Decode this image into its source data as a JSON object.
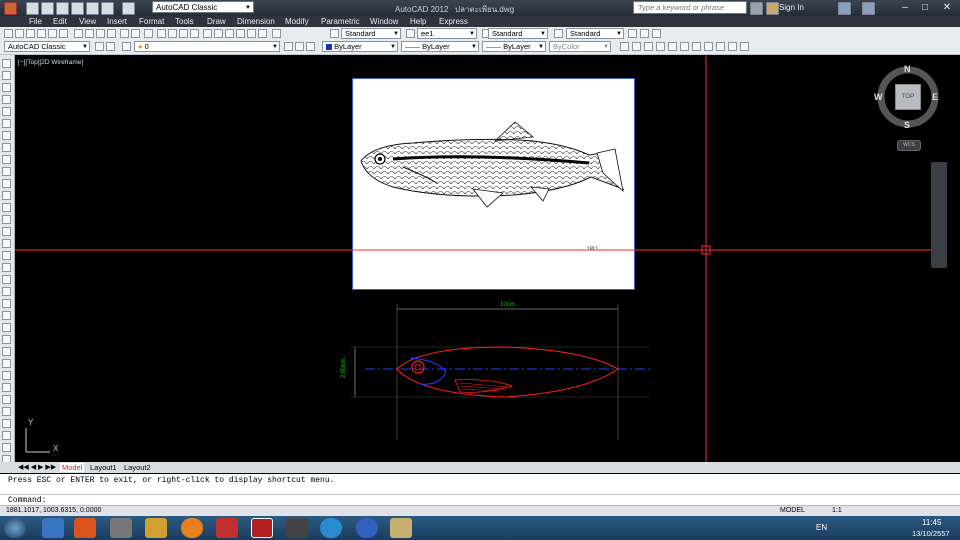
{
  "titlebar": {
    "workspace": "AutoCAD Classic",
    "app_title": "AutoCAD 2012",
    "file_name": "ปลาตะเพียน.dwg",
    "search_placeholder": "Type a keyword or phrase",
    "sign_in": "Sign In"
  },
  "menu": [
    "File",
    "Edit",
    "View",
    "Insert",
    "Format",
    "Tools",
    "Draw",
    "Dimension",
    "Modify",
    "Parametric",
    "Window",
    "Help",
    "Express"
  ],
  "toolbar1": {
    "text_style": "Standard",
    "dim_style": "ee1",
    "table_style": "Standard",
    "mleader_style": "Standard"
  },
  "toolbar2": {
    "workspace": "AutoCAD Classic",
    "layer": "0",
    "color": "ByLayer",
    "linetype": "ByLayer",
    "lineweight": "ByLayer",
    "plotstyle": "ByColor"
  },
  "viewport_label": "[−][Top][2D Wireframe]",
  "viewcube": {
    "n": "N",
    "s": "S",
    "e": "E",
    "w": "W",
    "top": "TOP",
    "wcs": "WCS"
  },
  "drawing": {
    "dim_width": "10cm.",
    "dim_height": "2.00cm.",
    "paper_note": "ปลา"
  },
  "ucs": {
    "x": "X",
    "y": "Y"
  },
  "tabs": [
    "Model",
    "Layout1",
    "Layout2"
  ],
  "command": {
    "history": "Press ESC or ENTER to exit, or right-click to display shortcut menu.",
    "prompt": "Command:"
  },
  "status": {
    "coords": "1881.1017, 1003.6315, 0.0000",
    "model": "MODEL",
    "scale": "1:1"
  },
  "taskbar": {
    "lang": "EN",
    "time": "11:45",
    "date": "13/10/2557"
  },
  "colors": {
    "crosshair": "#ff2a2a",
    "outline": "#ff2020",
    "centerline": "#2040ff",
    "dimension": "#00d800"
  }
}
